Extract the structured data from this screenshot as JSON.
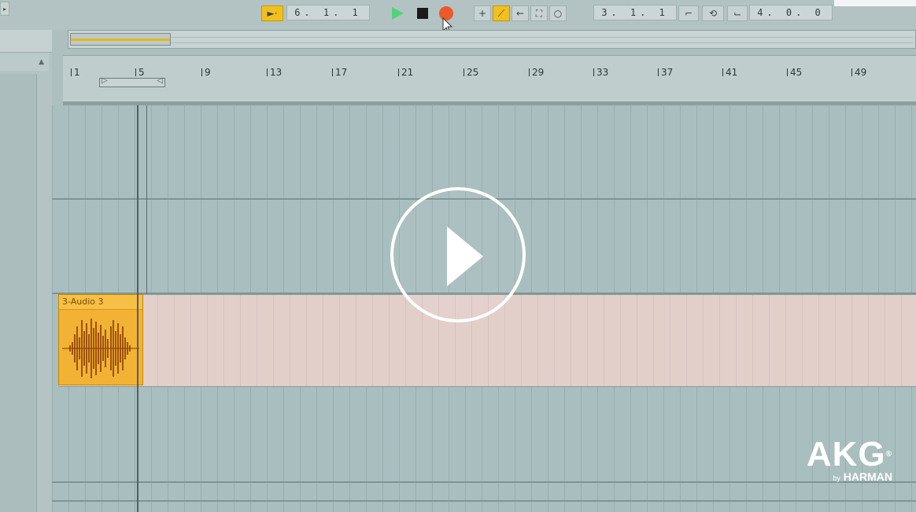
{
  "transport": {
    "arrangement_position": "6. 1. 1",
    "loop_start": "3. 1. 1",
    "loop_length": "4. 0. 0",
    "colors": {
      "play": "#54d27a",
      "stop": "#1a1a1a",
      "record": "#ec5a2a",
      "accent": "#f2c01d"
    }
  },
  "ruler": {
    "bars": [
      "1",
      "5",
      "9",
      "13",
      "17",
      "21",
      "25",
      "29",
      "33",
      "37",
      "41",
      "45",
      "49"
    ]
  },
  "tracks": [
    {
      "clip": {
        "name": "3-Audio 3",
        "color": "#f2b233"
      }
    }
  ],
  "overlay": {
    "icon": "play-circle-icon"
  },
  "logo": {
    "brand": "AKG",
    "registered": "®",
    "by": "by",
    "parent": "HARMAN"
  }
}
